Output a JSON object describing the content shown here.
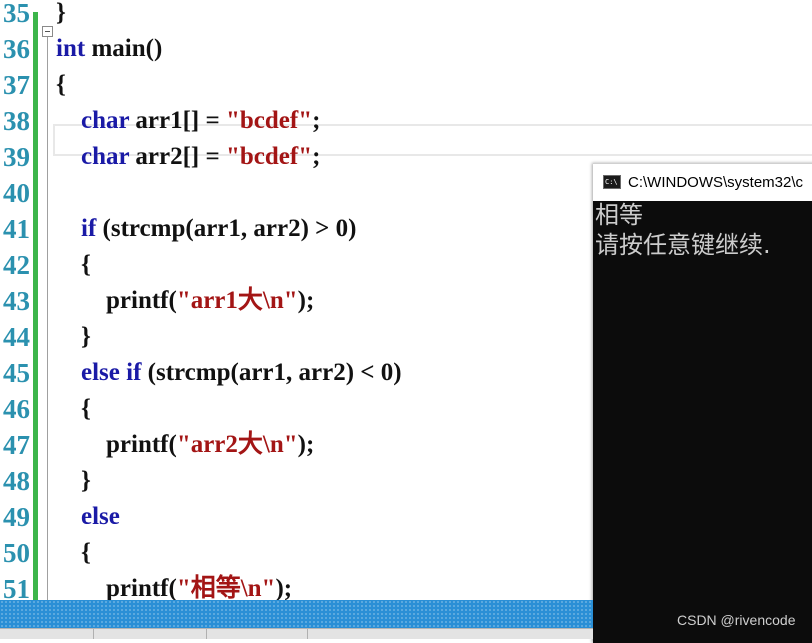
{
  "editor": {
    "line_numbers": [
      "35",
      "36",
      "37",
      "38",
      "39",
      "40",
      "41",
      "42",
      "43",
      "44",
      "45",
      "46",
      "47",
      "48",
      "49",
      "50",
      "51"
    ],
    "lines": [
      [
        {
          "t": "}",
          "c": "plain"
        }
      ],
      [
        {
          "t": "int",
          "c": "kw"
        },
        {
          "t": " main()",
          "c": "plain"
        }
      ],
      [
        {
          "t": "{",
          "c": "plain"
        }
      ],
      [
        {
          "t": "    ",
          "c": "plain"
        },
        {
          "t": "char",
          "c": "kw"
        },
        {
          "t": " arr1[] = ",
          "c": "plain"
        },
        {
          "t": "\"bcdef\"",
          "c": "str"
        },
        {
          "t": ";",
          "c": "plain"
        }
      ],
      [
        {
          "t": "    ",
          "c": "plain"
        },
        {
          "t": "char",
          "c": "kw"
        },
        {
          "t": " arr2[] = ",
          "c": "plain"
        },
        {
          "t": "\"bcdef\"",
          "c": "str"
        },
        {
          "t": ";",
          "c": "plain"
        }
      ],
      [],
      [
        {
          "t": "    ",
          "c": "plain"
        },
        {
          "t": "if",
          "c": "kw"
        },
        {
          "t": " (strcmp(arr1, arr2) > 0)",
          "c": "plain"
        }
      ],
      [
        {
          "t": "    {",
          "c": "plain"
        }
      ],
      [
        {
          "t": "        printf(",
          "c": "plain"
        },
        {
          "t": "\"arr1大\\n\"",
          "c": "str"
        },
        {
          "t": ");",
          "c": "plain"
        }
      ],
      [
        {
          "t": "    }",
          "c": "plain"
        }
      ],
      [
        {
          "t": "    ",
          "c": "plain"
        },
        {
          "t": "else if",
          "c": "kw"
        },
        {
          "t": " (strcmp(arr1, arr2) < 0)",
          "c": "plain"
        }
      ],
      [
        {
          "t": "    {",
          "c": "plain"
        }
      ],
      [
        {
          "t": "        printf(",
          "c": "plain"
        },
        {
          "t": "\"arr2大\\n\"",
          "c": "str"
        },
        {
          "t": ");",
          "c": "plain"
        }
      ],
      [
        {
          "t": "    }",
          "c": "plain"
        }
      ],
      [
        {
          "t": "    ",
          "c": "plain"
        },
        {
          "t": "else",
          "c": "kw"
        }
      ],
      [
        {
          "t": "    {",
          "c": "plain"
        }
      ],
      [
        {
          "t": "        printf(",
          "c": "plain"
        },
        {
          "t": "\"相等\\n\"",
          "c": "str"
        },
        {
          "t": ");",
          "c": "plain"
        }
      ]
    ]
  },
  "console": {
    "title": "C:\\WINDOWS\\system32\\c",
    "icon_text": "C:\\",
    "output_lines": [
      "相等",
      "请按任意键继续."
    ]
  },
  "watermark": "CSDN @rivencode",
  "colors": {
    "keyword": "#1a1aa6",
    "string": "#a31515",
    "line_number": "#2b91af",
    "change_bar": "#3cb54a",
    "scrollbar": "#2a8fd6",
    "console_bg": "#0c0c0c"
  }
}
